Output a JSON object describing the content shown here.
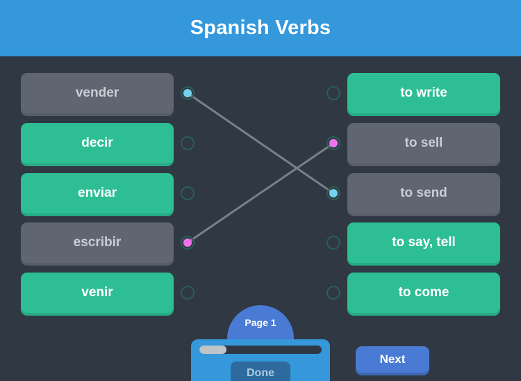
{
  "header": {
    "title": "Spanish Verbs",
    "background_color": "#3498db"
  },
  "theme": {
    "background_color": "#303843",
    "matched_color": "#2dbe94",
    "unmatched_color": "#5f6672",
    "accent_blue": "#3498db",
    "dot_blue": "#74d3ec",
    "dot_pink": "#ee72ee",
    "link_color": "#7a8089"
  },
  "left_column": [
    {
      "label": "vender",
      "state": "unmatched",
      "dot": "blue"
    },
    {
      "label": "decir",
      "state": "matched",
      "dot": "empty"
    },
    {
      "label": "enviar",
      "state": "matched",
      "dot": "empty"
    },
    {
      "label": "escribir",
      "state": "unmatched",
      "dot": "pink"
    },
    {
      "label": "venir",
      "state": "matched",
      "dot": "empty"
    }
  ],
  "right_column": [
    {
      "label": "to write",
      "state": "matched",
      "dot": "empty"
    },
    {
      "label": "to sell",
      "state": "unmatched",
      "dot": "pink"
    },
    {
      "label": "to send",
      "state": "unmatched",
      "dot": "blue"
    },
    {
      "label": "to say, tell",
      "state": "matched",
      "dot": "empty"
    },
    {
      "label": "to come",
      "state": "matched",
      "dot": "empty"
    }
  ],
  "links": [
    {
      "from_left_row": 0,
      "to_right_row": 2,
      "color": "#74d3ec"
    },
    {
      "from_left_row": 3,
      "to_right_row": 1,
      "color": "#ee72ee"
    }
  ],
  "footer": {
    "page_label": "Page 1",
    "progress_percent": 22,
    "done_label": "Done",
    "next_label": "Next"
  }
}
